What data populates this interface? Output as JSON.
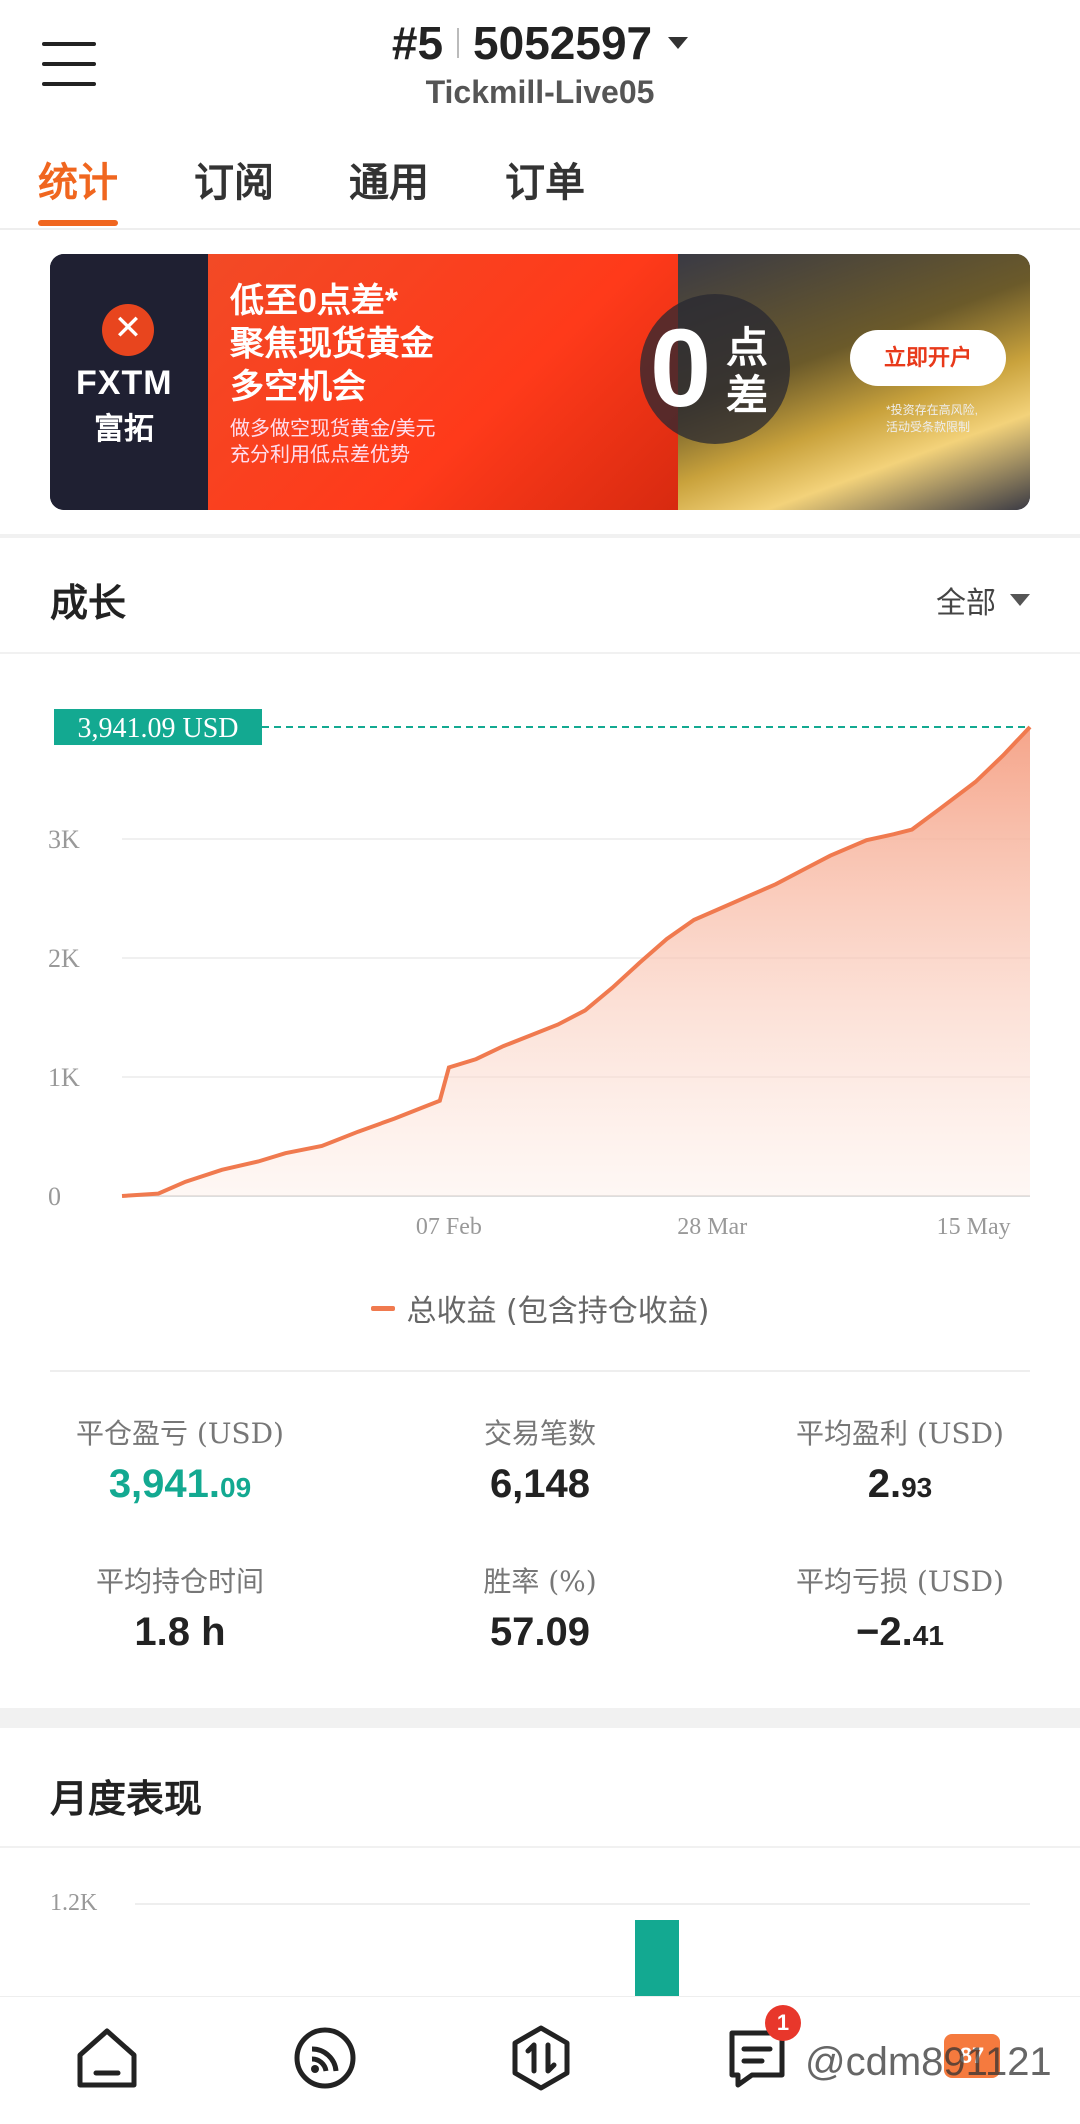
{
  "header": {
    "account_prefix": "#5",
    "account_number": "5052597",
    "server": "Tickmill-Live05"
  },
  "tabs": [
    "统计",
    "订阅",
    "通用",
    "订单"
  ],
  "banner": {
    "brand": "FXTM",
    "brand_cn": "富拓",
    "headline_1": "低至0点差*",
    "headline_2": "聚焦现货黄金",
    "headline_3": "多空机会",
    "sub_1": "做多做空现货黄金/美元",
    "sub_2": "充分利用低点差优势",
    "zero": "0",
    "zero_label_1": "点",
    "zero_label_2": "差",
    "cta": "立即开户",
    "risk_1": "*投资存在高风险,",
    "risk_2": "活动受条款限制"
  },
  "growth": {
    "title": "成长",
    "filter": "全部",
    "legend": "总收益 (包含持仓收益)"
  },
  "chart_data": {
    "type": "area",
    "ylim": [
      0,
      4000
    ],
    "y_ticks": [
      "0",
      "1K",
      "2K",
      "3K"
    ],
    "x_ticks": [
      "07 Feb",
      "28 Mar",
      "15 May"
    ],
    "current_value_label": "3,941.09 USD",
    "series": [
      {
        "name": "总收益 (包含持仓收益)",
        "color": "#f07a4f",
        "points": [
          [
            0.0,
            0
          ],
          [
            0.04,
            20
          ],
          [
            0.07,
            120
          ],
          [
            0.11,
            220
          ],
          [
            0.15,
            290
          ],
          [
            0.18,
            360
          ],
          [
            0.22,
            420
          ],
          [
            0.26,
            540
          ],
          [
            0.3,
            650
          ],
          [
            0.33,
            740
          ],
          [
            0.35,
            800
          ],
          [
            0.36,
            1080
          ],
          [
            0.39,
            1150
          ],
          [
            0.42,
            1260
          ],
          [
            0.45,
            1350
          ],
          [
            0.48,
            1440
          ],
          [
            0.51,
            1560
          ],
          [
            0.54,
            1750
          ],
          [
            0.57,
            1960
          ],
          [
            0.6,
            2160
          ],
          [
            0.63,
            2320
          ],
          [
            0.66,
            2420
          ],
          [
            0.69,
            2520
          ],
          [
            0.72,
            2620
          ],
          [
            0.75,
            2740
          ],
          [
            0.78,
            2860
          ],
          [
            0.82,
            2990
          ],
          [
            0.85,
            3040
          ],
          [
            0.87,
            3080
          ],
          [
            0.9,
            3250
          ],
          [
            0.94,
            3480
          ],
          [
            0.97,
            3700
          ],
          [
            1.0,
            3941.09
          ]
        ]
      }
    ]
  },
  "stats": {
    "closed_pl_label": "平仓盈亏 (USD)",
    "closed_pl_int": "3,941.",
    "closed_pl_dec": "09",
    "trades_label": "交易笔数",
    "trades_value": "6,148",
    "avg_profit_label": "平均盈利 (USD)",
    "avg_profit_int": "2.",
    "avg_profit_dec": "93",
    "avg_hold_label": "平均持仓时间",
    "avg_hold_value": "1.8 h",
    "win_rate_label": "胜率 (%)",
    "win_rate_value": "57.09",
    "avg_loss_label": "平均亏损 (USD)",
    "avg_loss_int": "−2.",
    "avg_loss_dec": "41"
  },
  "monthly": {
    "title": "月度表现",
    "y_tick": "1.2K"
  },
  "nav": {
    "badge_count": "1",
    "watermark": "@cdm891121",
    "chip": "87"
  },
  "colors": {
    "accent": "#f0661f",
    "green": "#13a991",
    "line": "#f07a4f"
  }
}
